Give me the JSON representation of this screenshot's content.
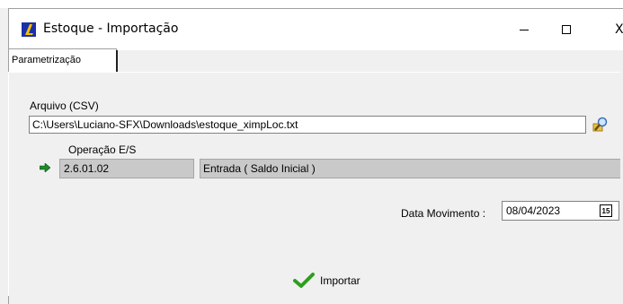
{
  "window": {
    "title": "Estoque - Importação",
    "app_icon": "L-logo-icon",
    "controls": {
      "minimize": "minimize-icon",
      "maximize": "maximize-icon",
      "close": "close-icon",
      "close_glyph": "X"
    }
  },
  "tabs": [
    {
      "label": "Parametrização",
      "active": true
    }
  ],
  "arquivo": {
    "label": "Arquivo (CSV)",
    "value": "C:\\Users\\Luciano-SFX\\Downloads\\estoque_ximpLoc.txt",
    "browse_icon": "search-folder-icon"
  },
  "operacao": {
    "label": "Operação E/S",
    "code": "2.6.01.02",
    "description": "Entrada ( Saldo Inicial )",
    "arrow_icon": "green-arrow-icon"
  },
  "data_movimento": {
    "label": "Data Movimento :",
    "value": "08/04/2023",
    "calendar_icon": "calendar-icon",
    "calendar_glyph": "15"
  },
  "actions": {
    "import_label": "Importar",
    "import_icon": "checkmark-icon"
  },
  "colors": {
    "accent_green": "#2e9e1f",
    "readonly_bg": "#c9c9c9",
    "icon_blue": "#1a2fa8"
  }
}
